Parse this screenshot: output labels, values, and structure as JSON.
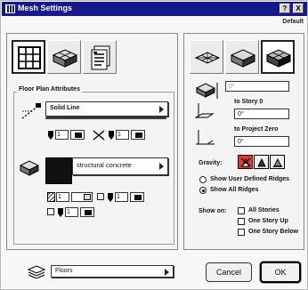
{
  "window": {
    "title": "Mesh Settings",
    "help_label": "?",
    "close_label": "X",
    "preset_label": "Default"
  },
  "tools": [
    "mesh-grid-icon",
    "mesh-3d-icon",
    "settings-sheet-icon"
  ],
  "floor_plan": {
    "group_title": "Floor Plan Attributes",
    "line_type": "Solid Line",
    "pen_value_1": "1",
    "pen_value_2": "1",
    "material_name": "structural concrete",
    "fill_value_1": "1",
    "fill_value_2": "1",
    "fill_value_3": "1"
  },
  "elevation": {
    "height_value": "0°",
    "to_story_label": "to Story 0",
    "to_story_value": "0°",
    "to_project_zero_label": "to Project Zero",
    "to_project_zero_value": "0°"
  },
  "gravity": {
    "label": "Gravity:"
  },
  "ridges": {
    "option_user": "Show User Defined Ridges",
    "option_all": "Show All Ridges",
    "selected": "option_all"
  },
  "show_on": {
    "label": "Show on:",
    "options": [
      "All Stories",
      "One Story Up",
      "One Story Below"
    ]
  },
  "layer": {
    "value": "Floors"
  },
  "buttons": {
    "cancel": "Cancel",
    "ok": "OK"
  }
}
